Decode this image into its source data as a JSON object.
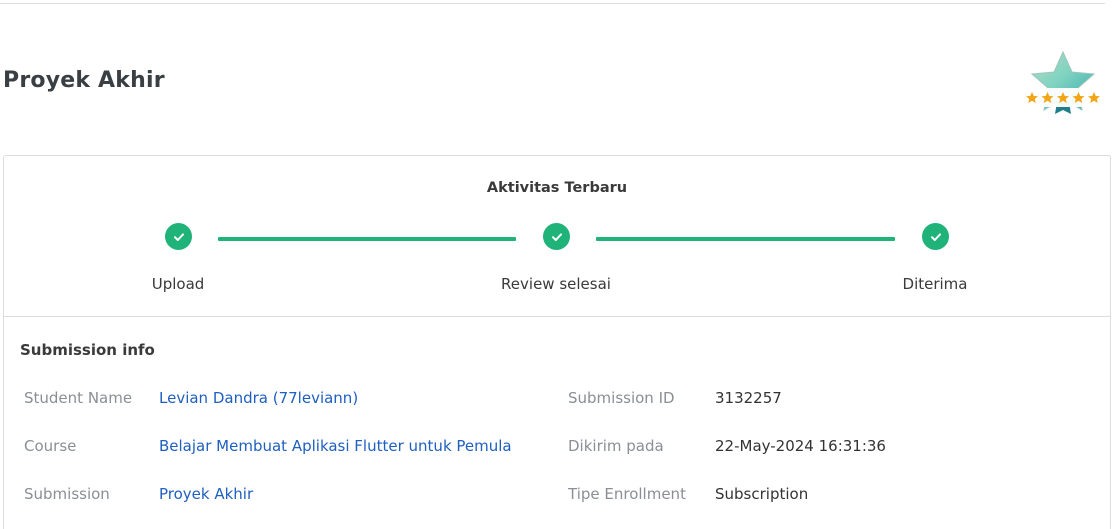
{
  "page": {
    "title": "Proyek Akhir"
  },
  "activity": {
    "title": "Aktivitas Terbaru",
    "steps": [
      {
        "label": "Upload"
      },
      {
        "label": "Review selesai"
      },
      {
        "label": "Diterima"
      }
    ],
    "accent_color": "#1fb37a"
  },
  "submission_info": {
    "title": "Submission info",
    "fields": {
      "student_name": {
        "label": "Student Name",
        "value": "Levian Dandra (77leviann)"
      },
      "course": {
        "label": "Course",
        "value": "Belajar Membuat Aplikasi Flutter untuk Pemula"
      },
      "submission": {
        "label": "Submission",
        "value": "Proyek Akhir"
      },
      "submission_id": {
        "label": "Submission ID",
        "value": "3132257"
      },
      "sent_at": {
        "label": "Dikirim pada",
        "value": "22-May-2024 16:31:36"
      },
      "enrollment_type": {
        "label": "Tipe Enrollment",
        "value": "Subscription"
      }
    }
  },
  "badge": {
    "icon": "star-rating-badge-icon",
    "stars": 5
  }
}
